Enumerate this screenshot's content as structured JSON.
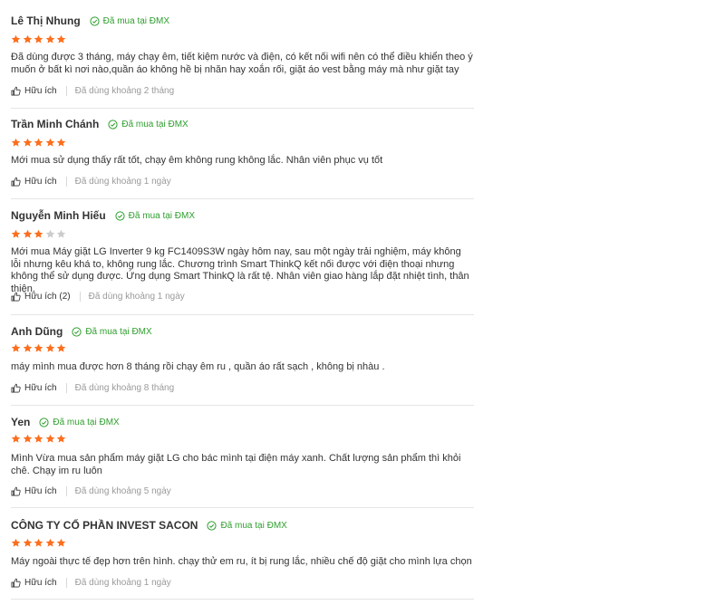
{
  "colors": {
    "star_filled": "#fd6e1d",
    "star_empty": "#cccccc",
    "verified_green": "#2f9e2f"
  },
  "reviews": [
    {
      "name": "Lê Thị Nhung",
      "badge": "Đã mua tại ĐMX",
      "rating": 5,
      "comment": "Đã dùng được 3 tháng, máy chạy êm, tiết kiệm nước và điện, có kết nối wifi nên có thể điều khiển theo ý muốn ở bất kì nơi nào,quần áo không hề bị nhăn hay xoắn rối, giặt áo vest bằng máy mà như giặt tay",
      "helpful": "Hữu ích",
      "used": "Đã dùng khoảng 2 tháng"
    },
    {
      "name": "Trần Minh Chánh",
      "badge": "Đã mua tại ĐMX",
      "rating": 5,
      "comment": "Mới mua sử dụng thấy rất tốt, chạy êm không rung không lắc. Nhân viên phục vụ tốt",
      "helpful": "Hữu ích",
      "used": "Đã dùng khoảng 1 ngày"
    },
    {
      "name": "Nguyễn Minh Hiếu",
      "badge": "Đã mua tại ĐMX",
      "rating": 3,
      "comment": "Mới mua Máy giặt LG Inverter 9 kg FC1409S3W ngày hôm nay, sau một ngày trải nghiệm, máy không lỗi nhưng kêu khá to, không rung lắc. Chương trình Smart ThinkQ kết nối được với điện thoại nhưng không thể sử dụng được. Ứng dụng Smart ThinkQ là rất tệ. Nhân viên giao hàng lắp đặt nhiệt tình, thân thiện.",
      "helpful": "Hữu ích (2)",
      "used": "Đã dùng khoảng 1 ngày"
    },
    {
      "name": "Anh Dũng",
      "badge": "Đã mua tại ĐMX",
      "rating": 5,
      "comment": "máy mình mua được hơn 8 tháng rồi chạy êm ru , quần áo rất sạch , không bị nhàu .",
      "helpful": "Hữu ích",
      "used": "Đã dùng khoảng 8 tháng"
    },
    {
      "name": "Yen",
      "badge": "Đã mua tại ĐMX",
      "rating": 5,
      "comment": "Mình Vừa mua sản phẩm máy giặt LG cho bác mình tại điện máy xanh. Chất lượng sản phẩm thì khỏi chê. Chạy im ru luôn",
      "helpful": "Hữu ích",
      "used": "Đã dùng khoảng 5 ngày"
    },
    {
      "name": "CÔNG TY CỔ PHẦN INVEST SACON",
      "badge": "Đã mua tại ĐMX",
      "rating": 5,
      "comment": "Máy ngoài thực tế đẹp hơn trên hình. chạy thử em ru, ít bị rung lắc, nhiều chế độ giặt cho mình lựa chọn",
      "helpful": "Hữu ích",
      "used": "Đã dùng khoảng 1 ngày"
    }
  ]
}
